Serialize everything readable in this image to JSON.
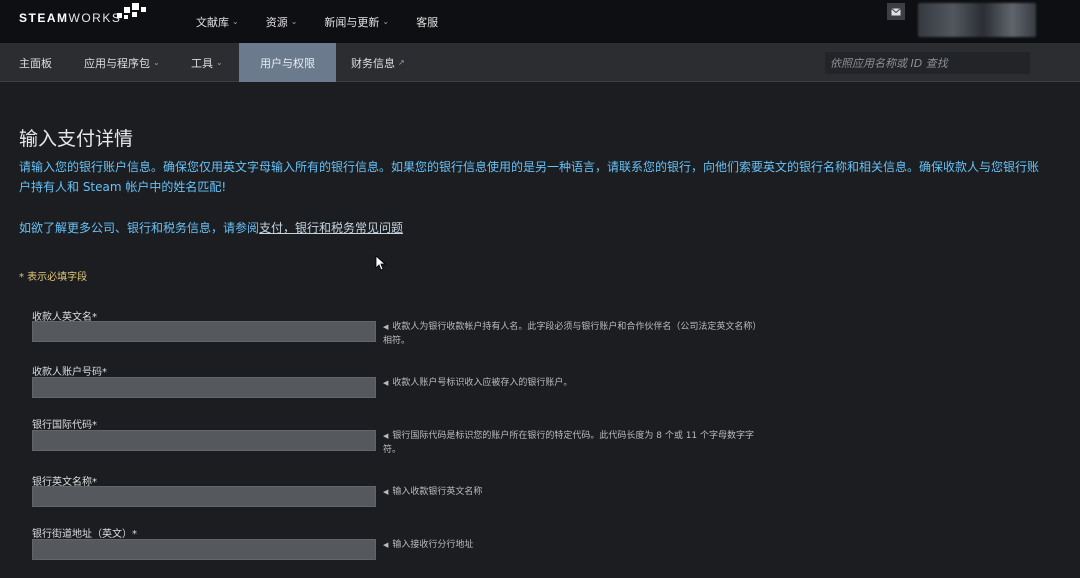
{
  "header": {
    "logo_bold": "STEAM",
    "logo_thin": "WORKS",
    "nav": [
      {
        "label": "文献库",
        "has_dropdown": true
      },
      {
        "label": "资源",
        "has_dropdown": true
      },
      {
        "label": "新闻与更新",
        "has_dropdown": true
      },
      {
        "label": "客服",
        "has_dropdown": false
      }
    ]
  },
  "subnav": {
    "items": [
      {
        "label": "主面板",
        "has_dropdown": false
      },
      {
        "label": "应用与程序包",
        "has_dropdown": true
      },
      {
        "label": "工具",
        "has_dropdown": true
      },
      {
        "label": "用户与权限",
        "active": true
      },
      {
        "label": "财务信息",
        "external": true
      }
    ],
    "search_placeholder": "依照应用名称或 ID 查找"
  },
  "main": {
    "title": "输入支付详情",
    "intro": "请输入您的银行账户信息。确保您仅用英文字母输入所有的银行信息。如果您的银行信息使用的是另一种语言，请联系您的银行，向他们索要英文的银行名称和相关信息。确保收款人与您银行账户持有人和 Steam 帐户中的姓名匹配!",
    "help_prefix": "如欲了解更多公司、银行和税务信息，请参阅",
    "help_link": "支付，银行和税务常见问题",
    "required_note": "* 表示必填字段",
    "fields": [
      {
        "label": "收款人英文名*",
        "value": "",
        "hint": "收款人为银行收款帐户持有人名。此字段必须与银行账户和合作伙伴名（公司法定英文名称）相符。"
      },
      {
        "label": "收款人账户号码*",
        "value": "",
        "hint": "收款人账户号标识收入应被存入的银行账户。"
      },
      {
        "label": "银行国际代码*",
        "value": "",
        "hint": "银行国际代码是标识您的账户所在银行的特定代码。此代码长度为 8 个或 11 个字母数字字符。"
      },
      {
        "label": "银行英文名称*",
        "value": "",
        "hint": "输入收款银行英文名称"
      },
      {
        "label": "银行街道地址（英文）*",
        "value": "",
        "hint": "输入接收行分行地址"
      }
    ]
  },
  "colors": {
    "accent_blue": "#67c1f5",
    "active_tab": "#6b7a8c",
    "required_yellow": "#e3c77a"
  }
}
